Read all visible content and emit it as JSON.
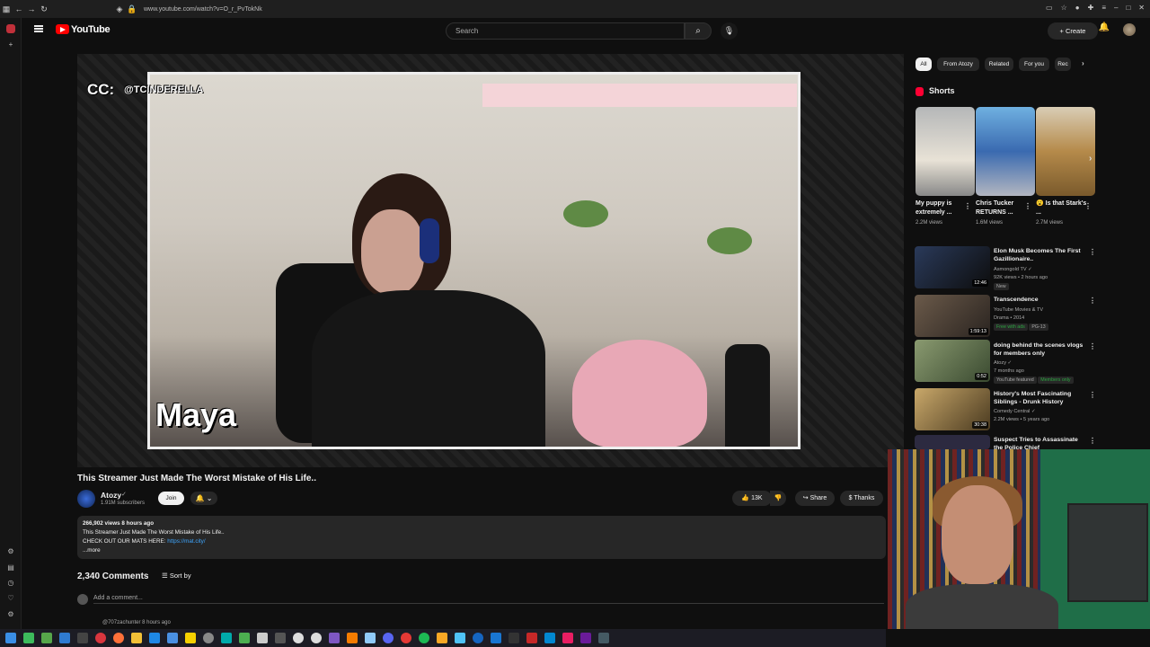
{
  "browser": {
    "url": "www.youtube.com/watch?v=O_r_PvTokNk"
  },
  "header": {
    "logo_text": "YouTube",
    "search_placeholder": "Search",
    "create_label": "Create"
  },
  "video": {
    "title": "This Streamer Just Made The Worst Mistake of His Life..",
    "overlay_cc": "CC:",
    "overlay_handle": "@TCINDERELLA",
    "overlay_name": "Maya",
    "channel": "Atozy",
    "subscribers": "1.91M subscribers",
    "join_label": "Join",
    "likes": "13K",
    "share_label": "Share",
    "thanks_label": "Thanks",
    "description": {
      "meta": "266,902 views  8 hours ago",
      "line1": "This Streamer Just Made The Worst Mistake of His Life..",
      "line2_prefix": "CHECK OUT OUR MATS HERE: ",
      "line2_link": "https://mat.city/",
      "more": "...more"
    }
  },
  "comments": {
    "count": "2,340 Comments",
    "sort_label": "Sort by",
    "add_placeholder": "Add a comment...",
    "next_author": "@707zachunter  8 hours ago"
  },
  "filters": [
    "All",
    "From Atozy",
    "Related",
    "For you",
    "Rec"
  ],
  "shorts": {
    "title": "Shorts",
    "items": [
      {
        "title": "My puppy is extremely ...",
        "views": "2.2M views"
      },
      {
        "title": "Chris Tucker RETURNS ...",
        "views": "1.6M views"
      },
      {
        "title": "😮 Is that Stark's ...",
        "views": "2.7M views"
      }
    ]
  },
  "recommendations": [
    {
      "title": "Elon Musk Becomes The First Gazillionaire..",
      "channel": "Asmongold TV ✓",
      "meta": "92K views • 2 hours ago",
      "badge": "New",
      "duration": "12:46",
      "thumb_color": "#2a3a5a"
    },
    {
      "title": "Transcendence",
      "channel": "YouTube Movies & TV",
      "meta": "Drama • 2014",
      "badge": "Free with ads",
      "rating": "PG-13",
      "duration": "1:59:13",
      "thumb_color": "#4a4038"
    },
    {
      "title": "doing behind the scenes vlogs for members only",
      "channel": "Atozy ✓",
      "meta": "7 months ago",
      "badge": "YouTube featured",
      "badge2": "Members only",
      "duration": "0:52",
      "thumb_color": "#6c7a58"
    },
    {
      "title": "History's Most Fascinating Siblings - Drunk History",
      "channel": "Comedy Central ✓",
      "meta": "2.2M views • 5 years ago",
      "duration": "30:38",
      "thumb_color": "#5c4a2e"
    },
    {
      "title": "Suspect Tries to Assassinate the Police Chief",
      "channel": "",
      "meta": "",
      "duration": "",
      "thumb_color": "#2c2a40"
    }
  ]
}
